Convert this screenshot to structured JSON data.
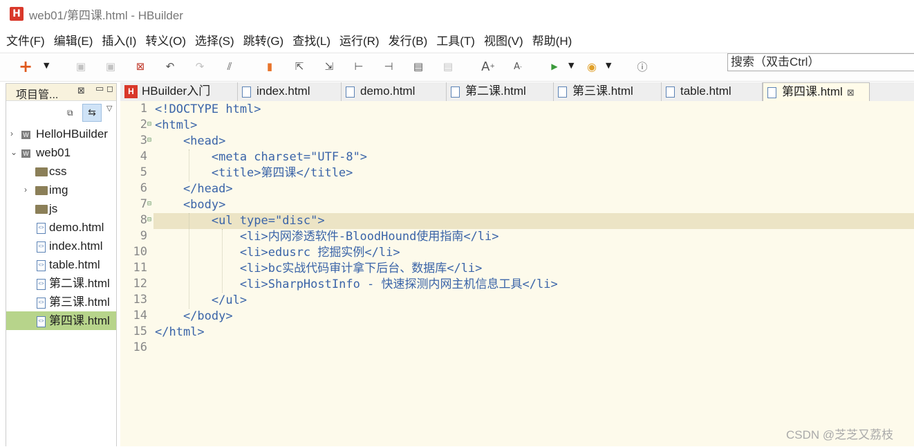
{
  "window": {
    "title": "web01/第四课.html  -  HBuilder",
    "logo": "H"
  },
  "menu": [
    "文件(F)",
    "编辑(E)",
    "插入(I)",
    "转义(O)",
    "选择(S)",
    "跳转(G)",
    "查找(L)",
    "运行(R)",
    "发行(B)",
    "工具(T)",
    "视图(V)",
    "帮助(H)"
  ],
  "toolbar": {
    "search_placeholder": "搜索（双击Ctrl）",
    "icons": [
      "new-icon",
      "save-icon",
      "save-all-icon",
      "close-file-icon",
      "undo-icon",
      "redo-icon",
      "format-icon",
      "bookmark-icon",
      "prev-bookmark-icon",
      "next-bookmark-icon",
      "jump-start-icon",
      "jump-end-icon",
      "toggle-comment-icon",
      "uncomment-icon",
      "font-increase-icon",
      "font-decrease-icon",
      "run-icon",
      "browser-icon",
      "info-icon"
    ]
  },
  "project_panel": {
    "title": "项目管...",
    "close": "⊠",
    "tree": [
      {
        "label": "HelloHBuilder",
        "type": "project",
        "expanded": false
      },
      {
        "label": "web01",
        "type": "project",
        "expanded": true
      },
      {
        "label": "css",
        "type": "folder"
      },
      {
        "label": "img",
        "type": "folder",
        "expandable": true
      },
      {
        "label": "js",
        "type": "folder"
      },
      {
        "label": "demo.html",
        "type": "file"
      },
      {
        "label": "index.html",
        "type": "file"
      },
      {
        "label": "table.html",
        "type": "file"
      },
      {
        "label": "第二课.html",
        "type": "file"
      },
      {
        "label": "第三课.html",
        "type": "file"
      },
      {
        "label": "第四课.html",
        "type": "file",
        "selected": true
      }
    ]
  },
  "tabs": [
    {
      "label": "HBuilder入门",
      "icon": "hbuilder-logo-icon"
    },
    {
      "label": "index.html"
    },
    {
      "label": "demo.html"
    },
    {
      "label": "第二课.html"
    },
    {
      "label": "第三课.html"
    },
    {
      "label": "table.html"
    },
    {
      "label": "第四课.html",
      "active": true,
      "close": "⊠"
    }
  ],
  "editor": {
    "line_numbers": [
      "1",
      "2",
      "3",
      "4",
      "5",
      "6",
      "7",
      "8",
      "9",
      "10",
      "11",
      "12",
      "13",
      "14",
      "15",
      "16"
    ],
    "current_line": 8,
    "code": [
      "<!DOCTYPE html>",
      "<html>",
      "    <head>",
      "        <meta charset=\"UTF-8\">",
      "        <title>第四课</title>",
      "    </head>",
      "    <body>",
      "        <ul type=\"disc\">",
      "            <li>内网渗透软件-BloodHound使用指南</li>",
      "            <li>edusrc 挖掘实例</li>",
      "            <li>bc实战代码审计拿下后台、数据库</li>",
      "            <li>SharpHostInfo - 快速探测内网主机信息工具</li>",
      "        </ul>",
      "    </body>",
      "</html>",
      ""
    ]
  },
  "watermark": "CSDN @芝芝又荔枝",
  "colors": {
    "tag": "#3a64a8",
    "attr": "#c22e1d",
    "string": "#2e8b57",
    "editor_bg": "#fdfaeb",
    "selected_file": "#b7d48b"
  }
}
